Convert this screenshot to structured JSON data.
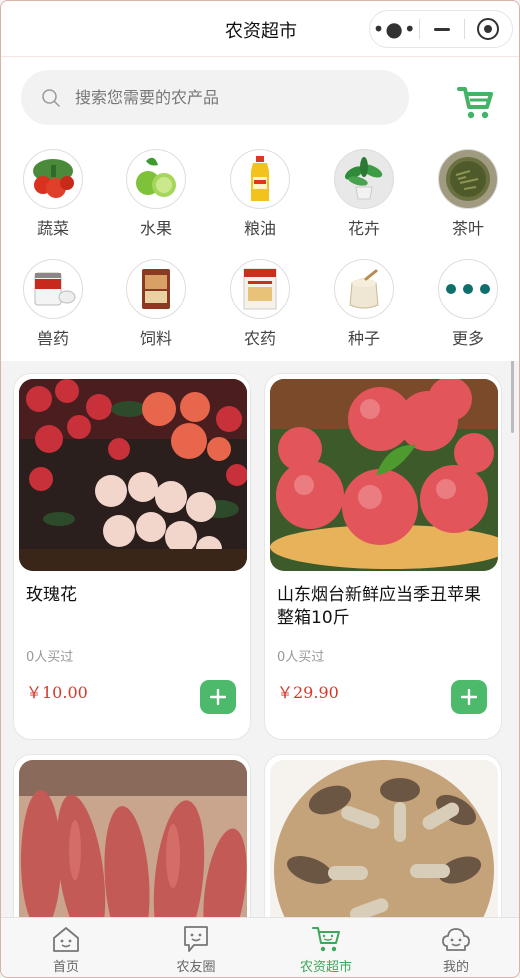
{
  "header": {
    "title": "农资超市"
  },
  "search": {
    "placeholder": "搜索您需要的农产品"
  },
  "categories": [
    {
      "label": "蔬菜",
      "icon": "vegetables-icon"
    },
    {
      "label": "水果",
      "icon": "fruit-icon"
    },
    {
      "label": "粮油",
      "icon": "grain-oil-icon"
    },
    {
      "label": "花卉",
      "icon": "flower-plant-icon"
    },
    {
      "label": "茶叶",
      "icon": "tea-leaves-icon"
    },
    {
      "label": "兽药",
      "icon": "vet-medicine-icon"
    },
    {
      "label": "饲料",
      "icon": "feed-bag-icon"
    },
    {
      "label": "农药",
      "icon": "pesticide-icon"
    },
    {
      "label": "种子",
      "icon": "seed-sack-icon"
    },
    {
      "label": "更多",
      "icon": "more-dots-icon"
    }
  ],
  "products": [
    {
      "name": "玫瑰花",
      "sold": "0人买过",
      "price": "￥10.00",
      "image": "roses-photo"
    },
    {
      "name": "山东烟台新鲜应当季丑苹果整箱10斤",
      "sold": "0人买过",
      "price": "￥29.90",
      "image": "apples-photo"
    },
    {
      "name": "",
      "sold": "",
      "price": "",
      "image": "sweet-potatoes-photo"
    },
    {
      "name": "",
      "sold": "",
      "price": "",
      "image": "matsutake-mushrooms-photo"
    }
  ],
  "tabs": [
    {
      "label": "首页",
      "icon": "home-icon",
      "active": false
    },
    {
      "label": "农友圈",
      "icon": "chat-bubble-icon",
      "active": false
    },
    {
      "label": "农资超市",
      "icon": "cart-icon",
      "active": true
    },
    {
      "label": "我的",
      "icon": "profile-icon",
      "active": false
    }
  ],
  "colors": {
    "accent": "#4cba6a",
    "price": "#d6392a",
    "active_tab": "#3fa75b"
  }
}
